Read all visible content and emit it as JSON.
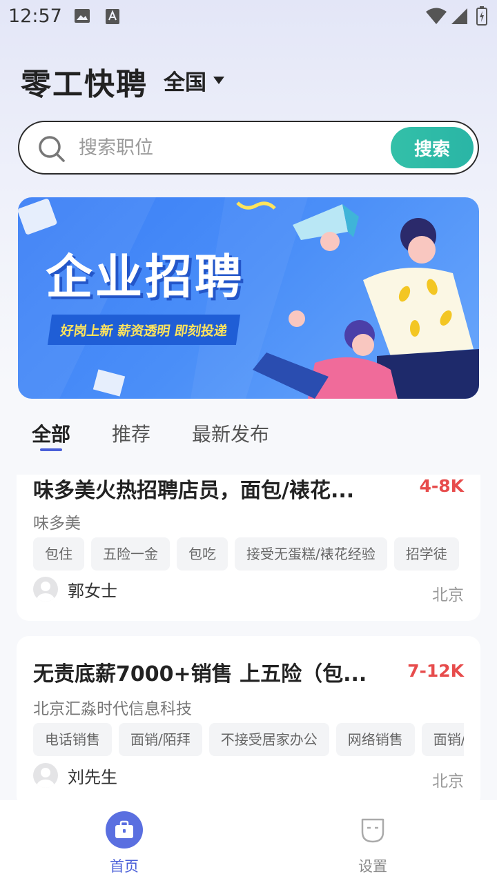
{
  "status_bar": {
    "time": "12:57"
  },
  "header": {
    "app_title": "零工快聘",
    "region": "全国"
  },
  "search": {
    "placeholder": "搜索职位",
    "button_label": "搜索"
  },
  "banner": {
    "title": "企业招聘",
    "slogan": "好岗上新  薪资透明  即刻投递"
  },
  "tabs": [
    {
      "label": "全部",
      "active": true
    },
    {
      "label": "推荐"
    },
    {
      "label": "最新发布"
    }
  ],
  "jobs": [
    {
      "title": "味多美火热招聘店员，面包/裱花...",
      "salary": "4-8K",
      "company": "味多美",
      "tags": [
        "包住",
        "五险一金",
        "包吃",
        "接受无蛋糕/裱花经验",
        "招学徒"
      ],
      "recruiter": "郭女士",
      "location": "北京"
    },
    {
      "title": "无责底薪7000+销售 上五险（包...",
      "salary": "7-12K",
      "company": "北京汇淼时代信息科技",
      "tags": [
        "电话销售",
        "面销/陌拜",
        "不接受居家办公",
        "网络销售",
        "面销/陌"
      ],
      "recruiter": "刘先生",
      "location": "北京"
    }
  ],
  "bottom_nav": [
    {
      "label": "首页",
      "icon": "briefcase-icon",
      "active": true
    },
    {
      "label": "设置",
      "icon": "settings-face-icon"
    }
  ],
  "colors": {
    "accent": "#4a5fd8",
    "search_button": "#2ab5a6",
    "salary": "#e74c4c"
  }
}
